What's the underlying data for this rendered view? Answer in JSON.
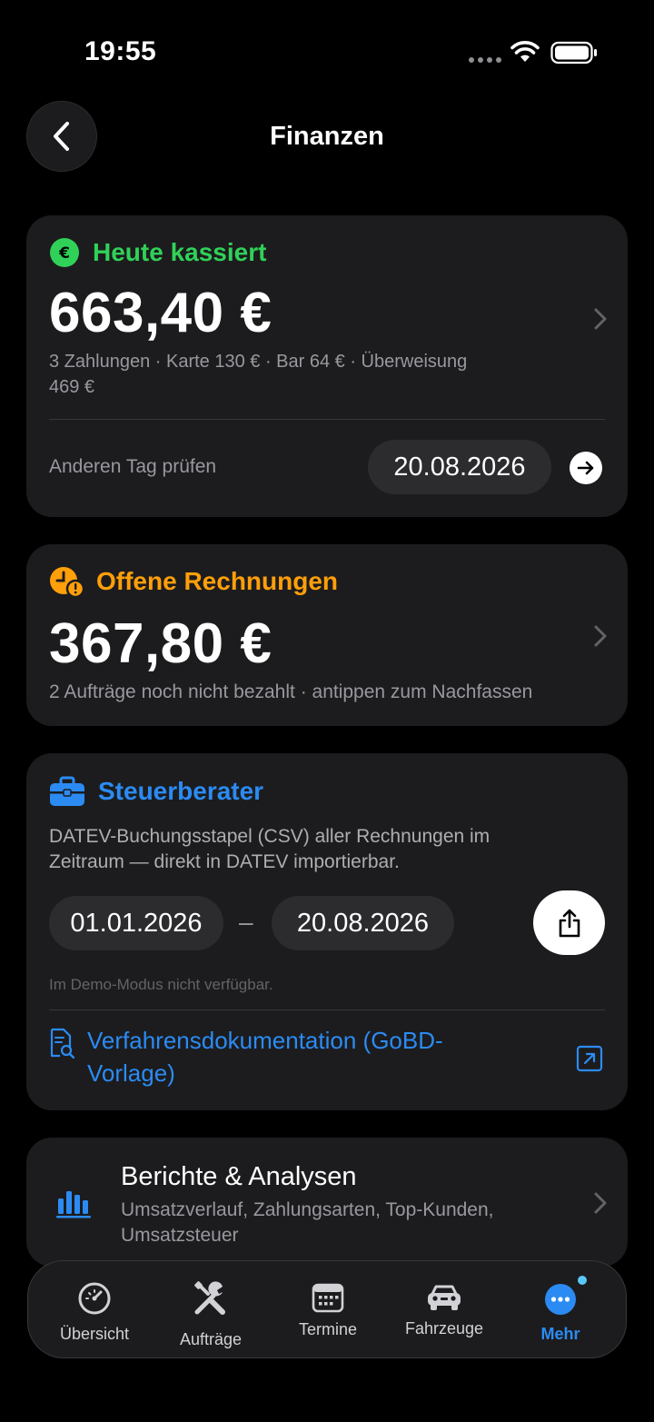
{
  "status": {
    "time": "19:55"
  },
  "nav": {
    "title": "Finanzen"
  },
  "today": {
    "title": "Heute kassiert",
    "amount": "663,40 €",
    "breakdown_line1": "3 Zahlungen · Karte 130 € · Bar 64 € · Überweisung",
    "breakdown_line2": "469 €",
    "other_day_label": "Anderen Tag prüfen",
    "date": "20.08.2026",
    "accent": "#30d158"
  },
  "open_invoices": {
    "title": "Offene Rechnungen",
    "amount": "367,80 €",
    "subtitle": "2 Aufträge noch nicht bezahlt · antippen zum Nachfassen",
    "accent": "#ff9f0a"
  },
  "tax_advisor": {
    "title": "Steuerberater",
    "desc_line1": "DATEV-Buchungsstapel (CSV) aller Rechnungen im",
    "desc_line2": "Zeitraum — direkt in DATEV importierbar.",
    "from_date": "01.01.2026",
    "dash": "–",
    "to_date": "20.08.2026",
    "demo_note": "Im Demo-Modus nicht verfügbar.",
    "doc_link_line1": "Verfahrensdokumentation (GoBD-",
    "doc_link_line2": "Vorlage)",
    "accent": "#2b8bf3"
  },
  "reports": {
    "title": "Berichte & Analysen",
    "subtitle_line1": "Umsatzverlauf, Zahlungsarten, Top-Kunden,",
    "subtitle_line2": "Umsatzsteuer"
  },
  "tabs": [
    {
      "label": "Übersicht",
      "icon": "speedometer-icon"
    },
    {
      "label": "Aufträge",
      "icon": "tools-icon"
    },
    {
      "label": "Termine",
      "icon": "calendar-icon"
    },
    {
      "label": "Fahrzeuge",
      "icon": "car-icon"
    },
    {
      "label": "Mehr",
      "icon": "more-icon",
      "active": true
    }
  ]
}
